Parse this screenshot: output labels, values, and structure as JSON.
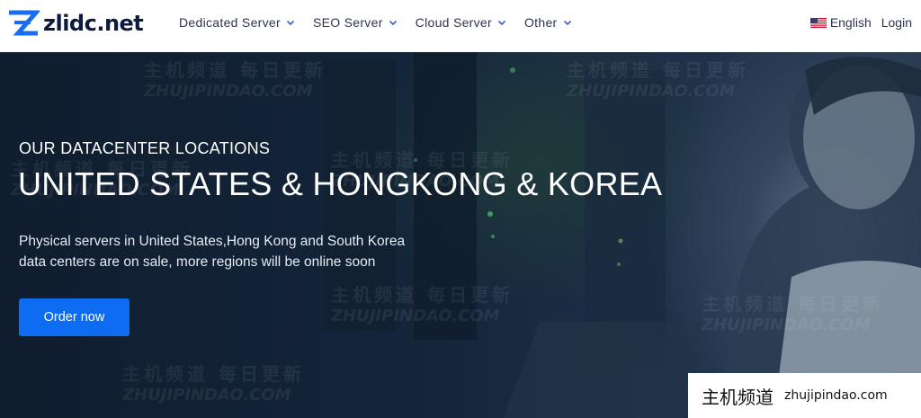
{
  "header": {
    "logo_text": "zlidc.net",
    "logo_icon": "z-logo-icon",
    "nav": [
      {
        "label": "Dedicated Server"
      },
      {
        "label": "SEO Server"
      },
      {
        "label": "Cloud Server"
      },
      {
        "label": "Other"
      }
    ],
    "language": "English",
    "language_flag": "us-flag-icon",
    "login": "Login"
  },
  "hero": {
    "eyebrow": "OUR DATACENTER LOCATIONS",
    "title": "UNITED STATES & HONGKONG & KOREA",
    "description_line1": "Physical servers in United States,Hong Kong and South Korea",
    "description_line2": "data centers are on sale, more regions will be online soon",
    "cta": "Order now"
  },
  "watermark": {
    "cn": "主机频道 每日更新",
    "en": "ZHUJIPINDAO.COM"
  },
  "badge": {
    "cn": "主机频道",
    "en": "zhujipindao.com"
  },
  "colors": {
    "accent": "#0e6cf3",
    "logo_blue": "#1a6cf0",
    "logo_text": "#0d1b3e",
    "hero_bg": "#14253a"
  }
}
